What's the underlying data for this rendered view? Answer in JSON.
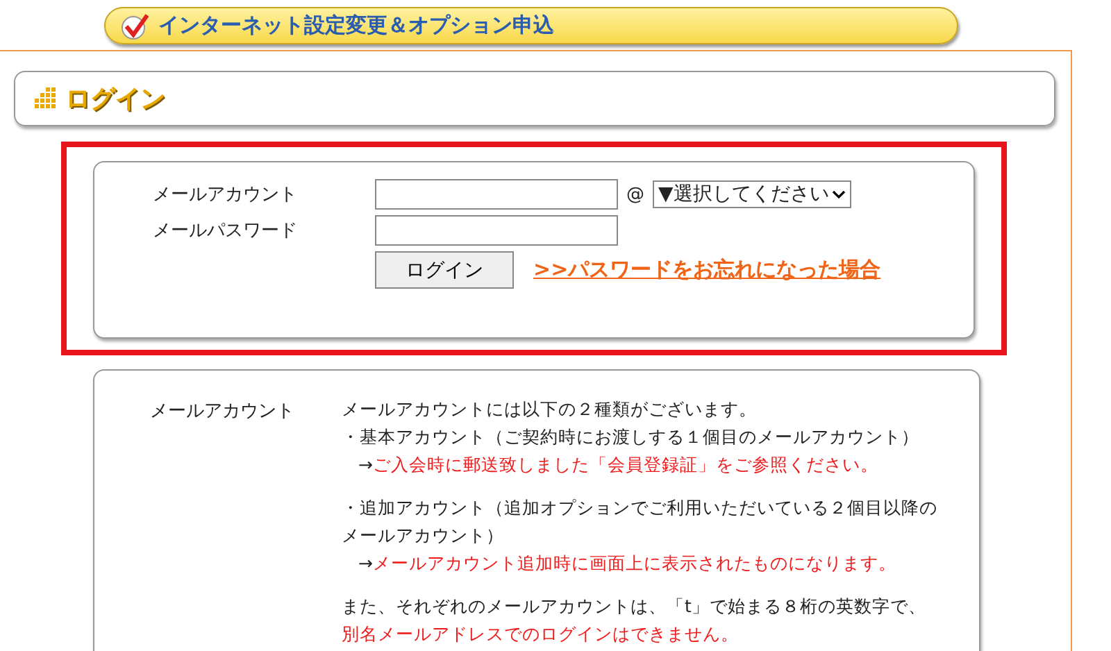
{
  "banner": {
    "title": "インターネット設定変更＆オプション申込"
  },
  "section": {
    "title": "ログイン"
  },
  "login_form": {
    "account_label": "メールアカウント",
    "at": "@",
    "domain_select": "▼選択してください",
    "password_label": "メールパスワード",
    "login_button": "ログイン",
    "forgot_link": ">>パスワードをお忘れになった場合"
  },
  "info": {
    "label": "メールアカウント",
    "paragraphs": [
      [
        {
          "kind": "plain",
          "text": "メールアカウントには以下の２種類がございます。"
        },
        {
          "kind": "plain",
          "text": "・基本アカウント（ご契約時にお渡しする１個目のメールアカウント）"
        },
        {
          "kind": "note",
          "arrow": "→",
          "text": "ご入会時に郵送致しました「会員登録証」をご参照ください。"
        }
      ],
      [
        {
          "kind": "plain",
          "text": "・追加アカウント（追加オプションでご利用いただいている２個目以降の"
        },
        {
          "kind": "plain",
          "text": "メールアカウント）"
        },
        {
          "kind": "note",
          "arrow": "→",
          "text": "メールアカウント追加時に画面上に表示されたものになります。"
        }
      ],
      [
        {
          "kind": "plain",
          "text": "また、それぞれのメールアカウントは、「t」で始まる８桁の英数字で、"
        },
        {
          "kind": "warning",
          "text": "別名メールアドレスでのログインはできません。"
        }
      ]
    ]
  }
}
